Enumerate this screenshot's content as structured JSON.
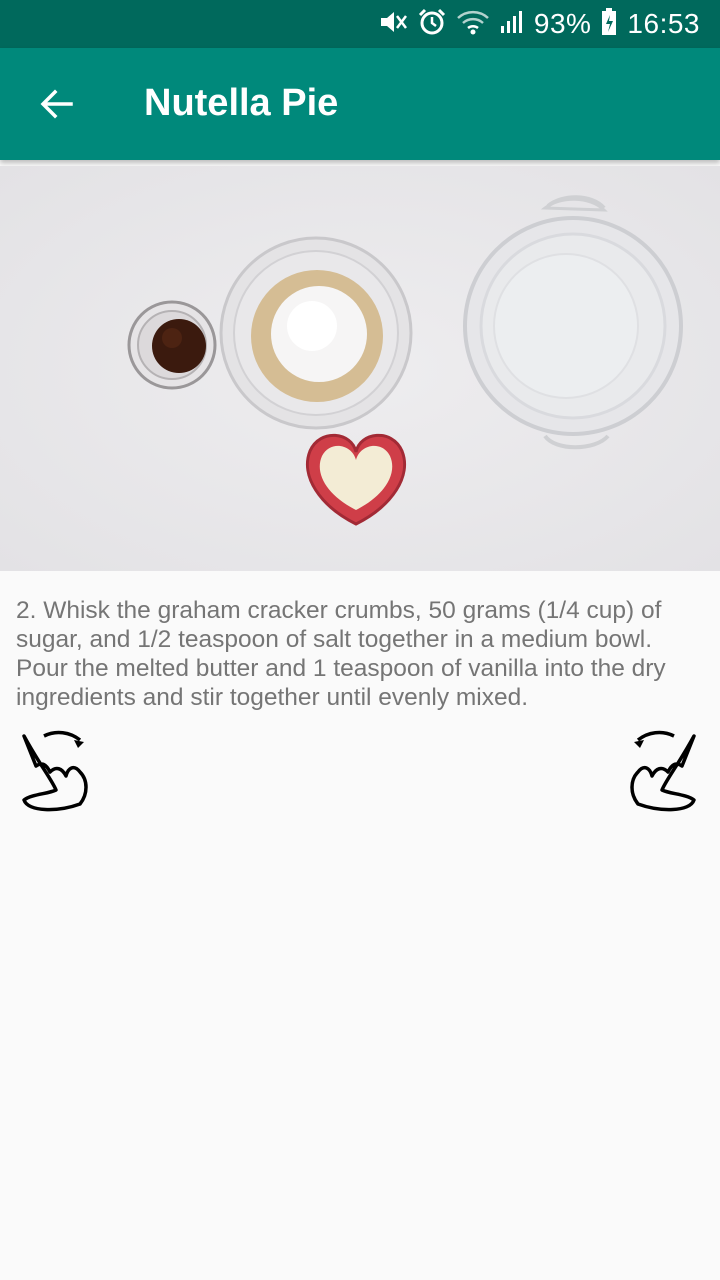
{
  "status_bar": {
    "battery": "93%",
    "time": "16:53",
    "icons": [
      "mute-icon",
      "alarm-icon",
      "wifi-icon",
      "signal-icon",
      "battery-icon"
    ]
  },
  "app_bar": {
    "title": "Nutella Pie",
    "back_icon": "arrow-back-icon",
    "background": "#00897b"
  },
  "step": {
    "text": "2. Whisk the graham cracker crumbs, 50 grams (1/4 cup) of sugar, and 1/2 teaspoon of salt together in a medium bowl. Pour the melted butter and 1 teaspoon of vanilla into the dry ingredients and stir together until evenly mixed."
  },
  "gestures": {
    "previous_icon": "swipe-left-hand-icon",
    "next_icon": "swipe-right-hand-icon"
  },
  "colors": {
    "status_bar": "#00695c",
    "app_bar": "#00897b",
    "body_text": "#757575",
    "background": "#fafafa"
  }
}
